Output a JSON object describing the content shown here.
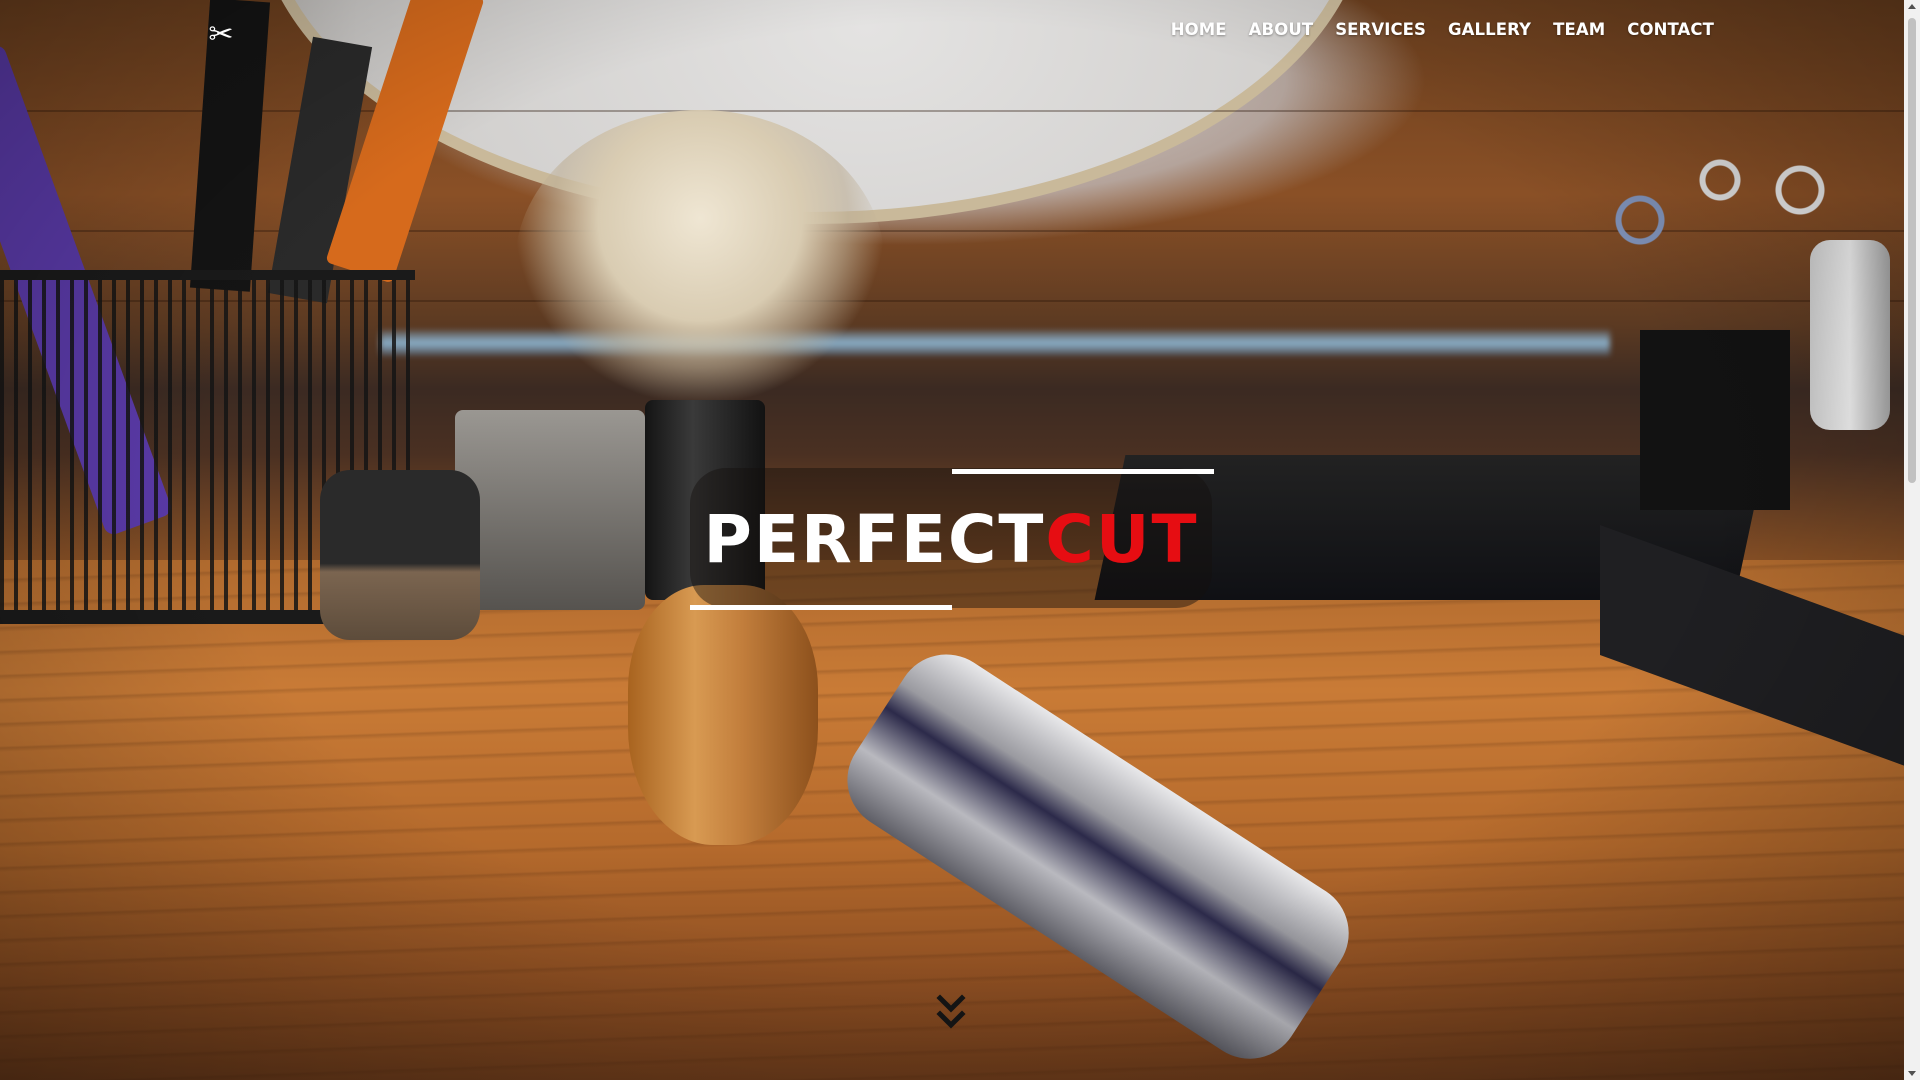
{
  "brand": {
    "logo_icon": "scissors-icon",
    "logo_glyph": "✂"
  },
  "nav": {
    "items": [
      {
        "label": "HOME"
      },
      {
        "label": "ABOUT"
      },
      {
        "label": "SERVICES"
      },
      {
        "label": "GALLERY"
      },
      {
        "label": "TEAM"
      },
      {
        "label": "CONTACT"
      }
    ]
  },
  "hero": {
    "title_main": "PERFECT",
    "title_accent": "CUT",
    "accent_color": "#e60d12",
    "scroll_icon": "double-chevron-down-icon"
  }
}
